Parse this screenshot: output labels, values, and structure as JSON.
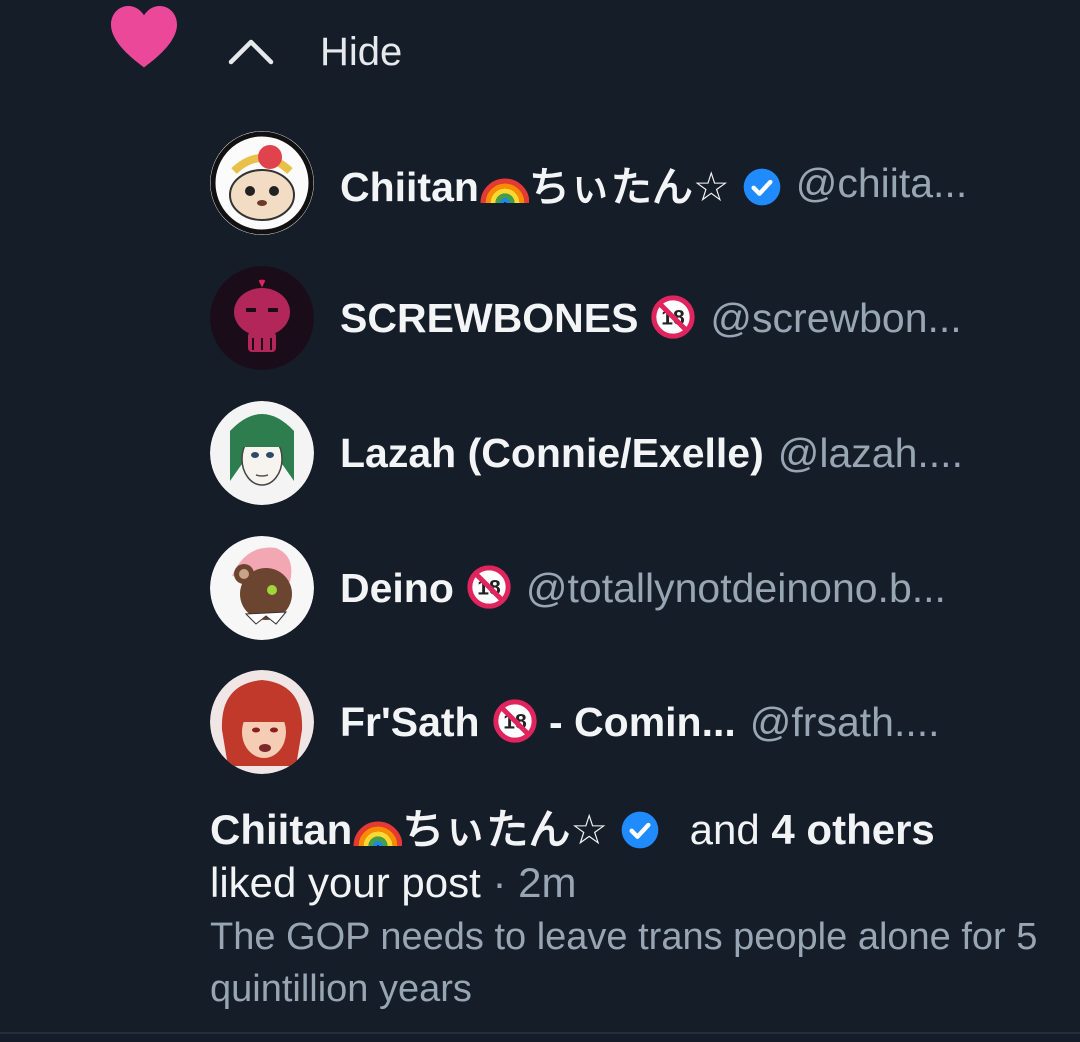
{
  "colors": {
    "background": "#151d28",
    "heart": "#ec4899",
    "muted": "#98a5b3",
    "verified": "#208bfe",
    "no18": "#e0245e"
  },
  "header": {
    "hide_label": "Hide"
  },
  "likers": [
    {
      "name": "Chiitan",
      "name_suffix": "ちぃたん☆",
      "handle": "@chiita...",
      "verified": true,
      "adult": false
    },
    {
      "name": "SCREWBONES",
      "name_suffix": "",
      "handle": "@screwbon...",
      "verified": false,
      "adult": true
    },
    {
      "name": "Lazah (Connie/Exelle)",
      "name_suffix": "",
      "handle": "@lazah....",
      "verified": false,
      "adult": false
    },
    {
      "name": "Deino",
      "name_suffix": "",
      "handle": "@totallynotdeinono.b...",
      "verified": false,
      "adult": true
    },
    {
      "name": "Fr'Sath",
      "name_suffix": "- Comin...",
      "handle": "@frsath....",
      "verified": false,
      "adult": true
    }
  ],
  "summary": {
    "name": "Chiitan",
    "name_suffix": "ちぃたん☆",
    "and_text": "and",
    "others": "4 others",
    "action": "liked your post",
    "separator": "·",
    "time": "2m",
    "post_text": "The GOP needs to leave trans people alone for 5 quintillion years"
  }
}
